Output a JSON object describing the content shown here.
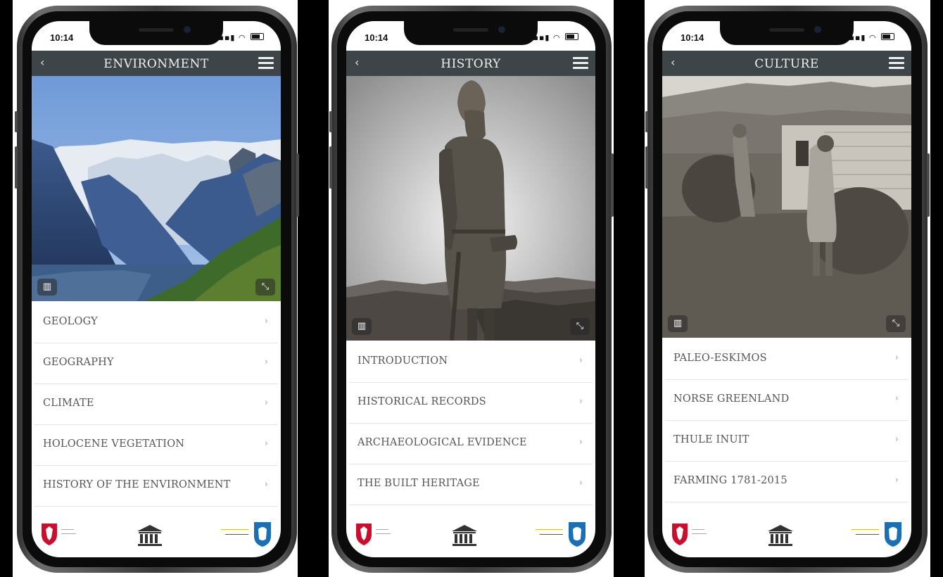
{
  "phones": [
    {
      "status": {
        "time": "10:14"
      },
      "nav": {
        "back": "‹",
        "title": "ENVIRONMENT"
      },
      "menu": [
        "GEOLOGY",
        "GEOGRAPHY",
        "CLIMATE",
        "HOLOCENE VEGETATION",
        "HISTORY OF THE ENVIRONMENT"
      ],
      "hero": "fjord-landscape"
    },
    {
      "status": {
        "time": "10:14"
      },
      "nav": {
        "back": "‹",
        "title": "HISTORY"
      },
      "menu": [
        "INTRODUCTION",
        "HISTORICAL RECORDS",
        "ARCHAEOLOGICAL EVIDENCE",
        "THE BUILT HERITAGE"
      ],
      "hero": "norse-statue"
    },
    {
      "status": {
        "time": "10:14"
      },
      "nav": {
        "back": "‹",
        "title": "CULTURE"
      },
      "menu": [
        "PALEO-ESKIMOS",
        "NORSE GREENLAND",
        "THULE INUIT",
        "FARMING 1781-2015"
      ],
      "hero": "haymaking-photo"
    }
  ],
  "icons": {
    "chevron": "›",
    "map": "map-book-icon",
    "expand": "expand-icon"
  },
  "colors": {
    "navbar": "#3d4548",
    "menu_text": "#555555",
    "logo_red": "#c8102e",
    "logo_blue": "#1a6fb5",
    "gov_yellow": "#c9b200"
  }
}
